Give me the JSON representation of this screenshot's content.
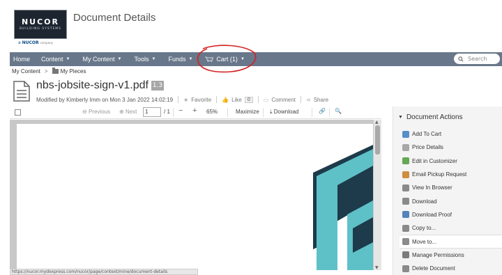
{
  "header": {
    "logo_main": "NUCOR",
    "logo_sub": "BUILDING SYSTEMS",
    "logo_tag": "NUCOR",
    "logo_tag_suffix": "company",
    "title": "Document Details"
  },
  "nav": {
    "items": [
      {
        "label": "Home",
        "caret": false
      },
      {
        "label": "Content",
        "caret": true
      },
      {
        "label": "My Content",
        "caret": true
      },
      {
        "label": "Tools",
        "caret": true
      },
      {
        "label": "Funds",
        "caret": true
      },
      {
        "label": "Cart (1)",
        "caret": true
      }
    ],
    "search_placeholder": "Search"
  },
  "breadcrumb": {
    "root": "My Content",
    "separator": ">",
    "current": "My Pieces"
  },
  "document": {
    "name": "nbs-jobsite-sign-v1.pdf",
    "version": "1.3",
    "modified": "Modified by Kimberly Imm on Mon 3 Jan 2022 14:02:19",
    "favorite": "Favorite",
    "like": "Like",
    "like_count": "0",
    "comment": "Comment",
    "share": "Share"
  },
  "viewer": {
    "previous": "Previous",
    "next": "Next",
    "page": "1",
    "page_total": "/ 1",
    "zoom": "65%",
    "maximize": "Maximize",
    "download": "Download"
  },
  "status_url": "https://nucor.mydexpress.com/nucor/page/context/mine/document-details",
  "actions_panel": {
    "title": "Document Actions",
    "items": [
      {
        "label": "Add To Cart",
        "icon": "cart-icon",
        "color": "#3a7bbf"
      },
      {
        "label": "Price Details",
        "icon": "price-tag-icon",
        "color": "#9a9a9a"
      },
      {
        "label": "Edit in Customizer",
        "icon": "edit-icon",
        "color": "#4a9a3a"
      },
      {
        "label": "Email Pickup Request",
        "icon": "email-icon",
        "color": "#c87a20"
      },
      {
        "label": "View In Browser",
        "icon": "browser-icon",
        "color": "#777777"
      },
      {
        "label": "Download",
        "icon": "download-icon",
        "color": "#777777"
      },
      {
        "label": "Download Proof",
        "icon": "proof-icon",
        "color": "#3a6fb0"
      },
      {
        "label": "Copy to...",
        "icon": "copy-icon",
        "color": "#777777"
      },
      {
        "label": "Move to...",
        "icon": "move-icon",
        "color": "#777777"
      },
      {
        "label": "Manage Permissions",
        "icon": "key-icon",
        "color": "#666666"
      },
      {
        "label": "Delete Document",
        "icon": "delete-icon",
        "color": "#777777"
      }
    ]
  },
  "colors": {
    "navbar": "#68778a",
    "annotation": "#d42020",
    "graphic_dark": "#1d3b4a",
    "graphic_teal": "#5fc1c8"
  }
}
